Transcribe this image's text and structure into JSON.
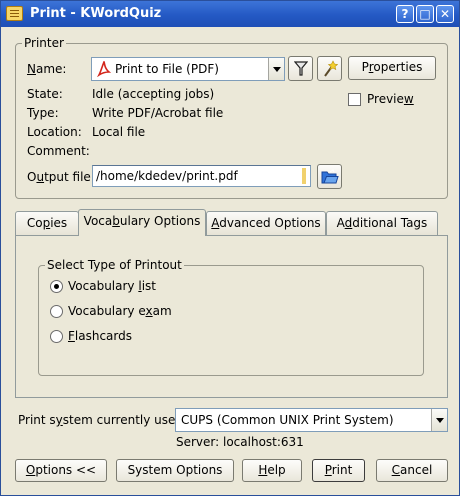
{
  "window": {
    "title": "Print - KWordQuiz",
    "help_glyph": "?",
    "maximize_glyph": "□",
    "close_glyph": "✕"
  },
  "printer": {
    "group_title": "Printer",
    "name_label_u": "N",
    "name_label_rest": "ame:",
    "selected_printer": "Print to File (PDF)",
    "properties_u": "r",
    "properties_pre": "P",
    "properties_post": "operties",
    "preview_pre": "Previe",
    "preview_u": "w",
    "state_label": "State:",
    "state_value": "Idle (accepting jobs)",
    "type_label": "Type:",
    "type_value": "Write PDF/Acrobat file",
    "location_label": "Location:",
    "location_value": "Local file",
    "comment_label": "Comment:",
    "comment_value": "",
    "output_label_pre": "O",
    "output_label_u": "u",
    "output_label_post": "tput file:",
    "output_value": "/home/kdedev/print.pdf"
  },
  "tabs": [
    {
      "pre": "Co",
      "u": "p",
      "post": "ies"
    },
    {
      "pre": "Voca",
      "u": "b",
      "post": "ulary Options"
    },
    {
      "pre": "",
      "u": "A",
      "post": "dvanced Options"
    },
    {
      "pre": "A",
      "u": "d",
      "post": "ditional Tags"
    }
  ],
  "printout": {
    "group_title": "Select Type of Printout",
    "options": [
      {
        "pre": "Vocabulary ",
        "u": "l",
        "post": "ist",
        "checked": true
      },
      {
        "pre": "Vocabulary e",
        "u": "x",
        "post": "am",
        "checked": false
      },
      {
        "pre": "",
        "u": "F",
        "post": "lashcards",
        "checked": false
      }
    ]
  },
  "system": {
    "label_pre": "Print s",
    "label_u": "y",
    "label_post": "stem currently used:",
    "value": "CUPS (Common UNIX Print System)",
    "server": "Server: localhost:631"
  },
  "buttons": {
    "options_u": "O",
    "options_post": "ptions <<",
    "system_options": "System Options",
    "help_u": "H",
    "help_post": "elp",
    "print_u": "P",
    "print_post": "rint",
    "cancel_u": "C",
    "cancel_post": "ancel"
  }
}
